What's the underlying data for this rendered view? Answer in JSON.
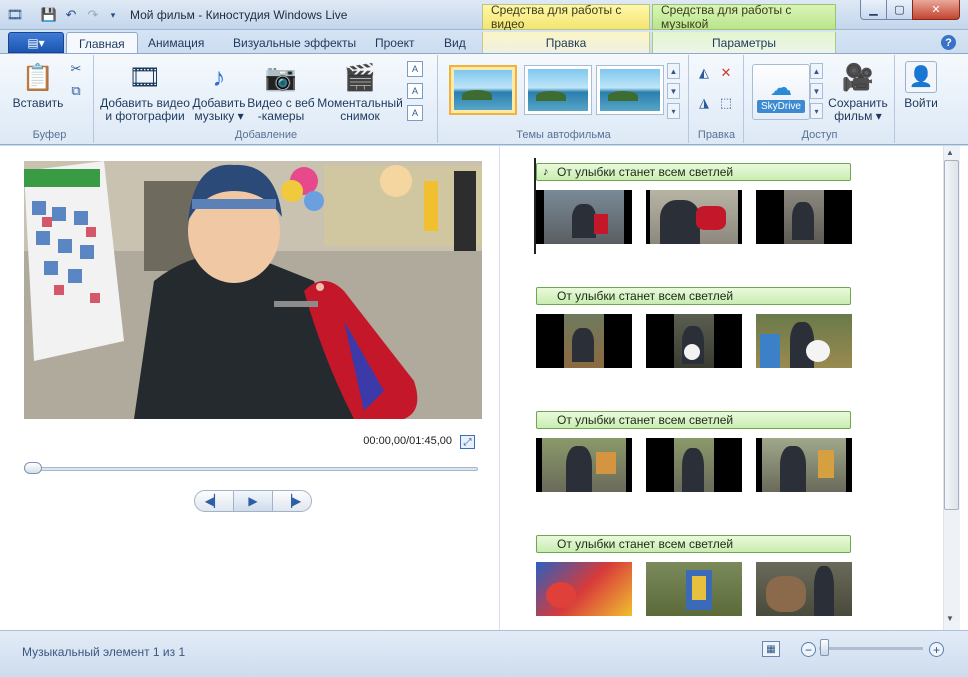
{
  "window": {
    "title": "Мой фильм - Киностудия Windows Live"
  },
  "contextual": {
    "video_tools": "Средства для работы с видео",
    "music_tools": "Средства для работы с музыкой",
    "video_tab": "Правка",
    "music_tab": "Параметры"
  },
  "tabs": [
    {
      "label": "Главная",
      "active": true
    },
    {
      "label": "Анимация"
    },
    {
      "label": "Визуальные эффекты"
    },
    {
      "label": "Проект"
    },
    {
      "label": "Вид"
    }
  ],
  "ribbon": {
    "clipboard": {
      "paste": "Вставить",
      "group": "Буфер"
    },
    "add": {
      "add_video_l1": "Добавить видео",
      "add_video_l2": "и фотографии",
      "add_music_l1": "Добавить",
      "add_music_l2": "музыку",
      "webcam_l1": "Видео с веб",
      "webcam_l2": "-камеры",
      "snapshot_l1": "Моментальный",
      "snapshot_l2": "снимок",
      "group": "Добавление"
    },
    "themes": {
      "group": "Темы автофильма"
    },
    "edit": {
      "group": "Правка"
    },
    "share": {
      "skydrive": "SkyDrive",
      "save_l1": "Сохранить",
      "save_l2": "фильм",
      "group": "Доступ"
    },
    "signin": {
      "label": "Войти"
    }
  },
  "preview": {
    "timecode": "00:00,00/01:45,00"
  },
  "storyboard": {
    "music_title": "От улыбки станет всем светлей"
  },
  "status": {
    "text": "Музыкальный элемент 1 из 1"
  },
  "colors": {
    "accent": "#1c56b3",
    "video_ctx": "#f3e570",
    "music_ctx": "#b9e58c",
    "music_bar": "#c9ecb0"
  }
}
